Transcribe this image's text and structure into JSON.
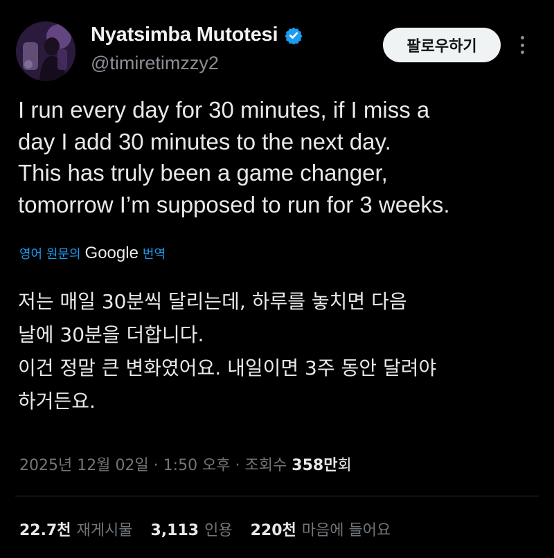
{
  "author": {
    "display_name": "Nyatsimba Mutotesi",
    "handle": "@timiretimzzy2",
    "verified_icon": "verified-badge-icon",
    "avatar_icon": "avatar-photo"
  },
  "header": {
    "follow_label": "팔로우하기",
    "more_icon": "more-options-icon"
  },
  "tweet": {
    "lines": [
      "I run every day for 30 minutes, if I miss a",
      "day I add 30 minutes to the next day.",
      "This has truly been a game changer,",
      "tomorrow I’m supposed to run for 3 weeks."
    ]
  },
  "translation": {
    "prefix": "영어 원문의",
    "provider": "Google",
    "suffix": "번역",
    "lines": [
      "저는 매일 30분씩 달리는데, 하루를 놓치면 다음",
      "날에 30분을 더합니다.",
      "이건 정말 큰 변화였어요. 내일이면 3주 동안 달려야",
      "하거든요."
    ]
  },
  "meta": {
    "date": "2025년 12월 02일",
    "separator": " · ",
    "time": "1:50 오후",
    "views_label": "조회수 ",
    "views_count": "358만",
    "views_unit": "회"
  },
  "stats": {
    "reposts_count": "22.7천",
    "reposts_label": "재게시물",
    "quotes_count": "3,113",
    "quotes_label": "인용",
    "likes_count": "220천",
    "likes_label": "마음에 들어요"
  },
  "colors": {
    "background": "#000000",
    "text": "#e7e9ea",
    "muted": "#71767b",
    "accent": "#1d9bf0"
  }
}
